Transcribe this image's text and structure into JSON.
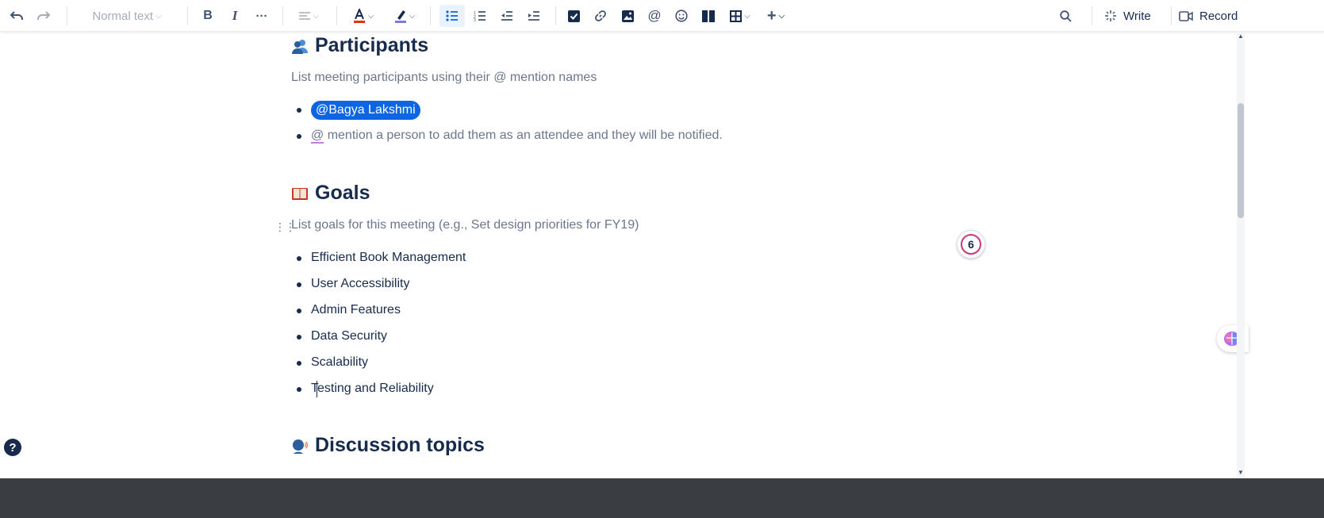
{
  "toolbar": {
    "text_style": "Normal text",
    "write_label": "Write",
    "record_label": "Record"
  },
  "sections": {
    "participants": {
      "heading": "Participants",
      "placeholder": "List meeting participants using their @ mention names",
      "mention": "@Bagya Lakshmi",
      "hint_at": "@",
      "hint_rest": " mention a person to add them as an attendee and they will be notified."
    },
    "goals": {
      "heading": "Goals",
      "placeholder": "List goals for this meeting (e.g., Set design priorities for FY19)",
      "items": [
        "Efficient Book Management",
        "User Accessibility",
        "Admin Features",
        "Data Security",
        "Scalability",
        "Testing and Reliability"
      ]
    },
    "discussion": {
      "heading": "Discussion topics"
    }
  },
  "comment_count": "6",
  "help_glyph": "?",
  "colors": {
    "accent": "#0c66e4",
    "text": "#172b4d",
    "muted": "#6b778c",
    "comment_ring": "#c9377a"
  }
}
